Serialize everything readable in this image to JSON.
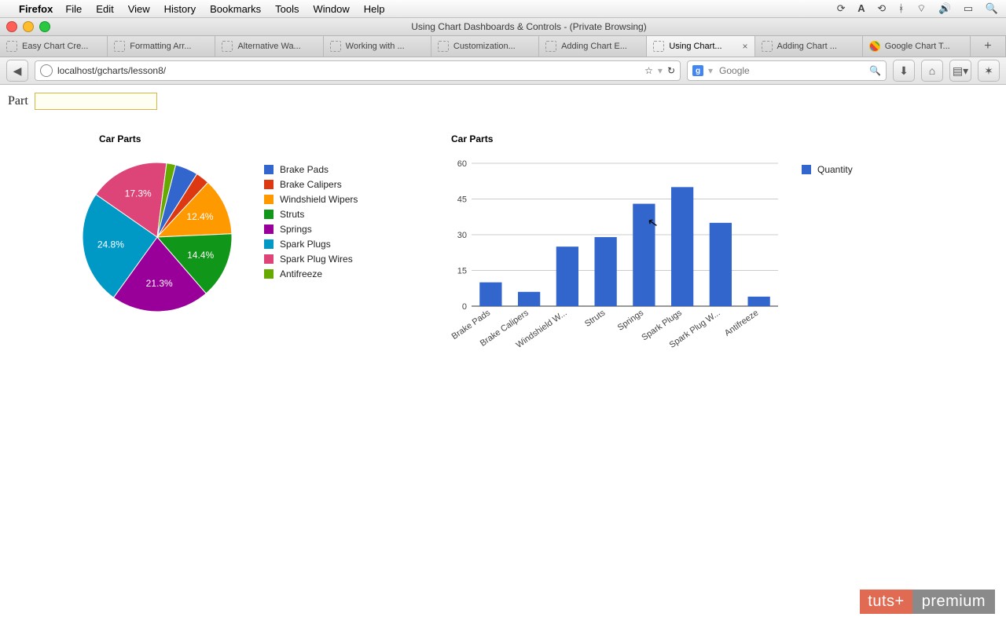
{
  "menubar": {
    "app": "Firefox",
    "items": [
      "File",
      "Edit",
      "View",
      "History",
      "Bookmarks",
      "Tools",
      "Window",
      "Help"
    ]
  },
  "window": {
    "title": "Using Chart Dashboards & Controls - (Private Browsing)"
  },
  "tabs": [
    {
      "label": "Easy Chart Cre..."
    },
    {
      "label": "Formatting Arr..."
    },
    {
      "label": "Alternative Wa..."
    },
    {
      "label": "Working with ..."
    },
    {
      "label": "Customization..."
    },
    {
      "label": "Adding Chart E..."
    },
    {
      "label": "Using Chart...",
      "active": true
    },
    {
      "label": "Adding Chart ..."
    },
    {
      "label": "Google Chart T...",
      "google": true
    }
  ],
  "url": {
    "value": "localhost/gcharts/lesson8/",
    "star": "☆",
    "reload": "↻"
  },
  "search": {
    "placeholder": "Google",
    "brand": "g",
    "magnify": "🔍"
  },
  "part_filter": {
    "label": "Part",
    "value": ""
  },
  "pie": {
    "title": "Car Parts",
    "legend": [
      "Brake Pads",
      "Brake Calipers",
      "Windshield Wipers",
      "Struts",
      "Springs",
      "Spark Plugs",
      "Spark Plug Wires",
      "Antifreeze"
    ],
    "colors": [
      "#3366cc",
      "#dc3912",
      "#ff9900",
      "#109618",
      "#990099",
      "#0099c6",
      "#dd4477",
      "#66aa00"
    ],
    "visible_labels": [
      "17.3%",
      "12.4%",
      "14.4%",
      "21.3%",
      "24.8%"
    ]
  },
  "bar": {
    "title": "Car Parts",
    "legend": "Quantity",
    "yticks": [
      "0",
      "15",
      "30",
      "45",
      "60"
    ]
  },
  "watermark": {
    "a": "tuts+",
    "b": "premium"
  },
  "chart_data": [
    {
      "type": "pie",
      "title": "Car Parts",
      "categories": [
        "Brake Pads",
        "Brake Calipers",
        "Windshield Wipers",
        "Struts",
        "Springs",
        "Spark Plugs",
        "Spark Plug Wires",
        "Antifreeze"
      ],
      "values": [
        10,
        6,
        25,
        29,
        43,
        50,
        35,
        4
      ],
      "percent_labels": {
        "Windshield Wipers": "12.4%",
        "Struts": "14.4%",
        "Springs": "21.3%",
        "Spark Plugs": "24.8%",
        "Spark Plug Wires": "17.3%"
      },
      "colors": [
        "#3366cc",
        "#dc3912",
        "#ff9900",
        "#109618",
        "#990099",
        "#0099c6",
        "#dd4477",
        "#66aa00"
      ]
    },
    {
      "type": "bar",
      "title": "Car Parts",
      "series": [
        {
          "name": "Quantity",
          "values": [
            10,
            6,
            25,
            29,
            43,
            50,
            35,
            4
          ]
        }
      ],
      "categories": [
        "Brake Pads",
        "Brake Calipers",
        "Windshield Wipers",
        "Struts",
        "Springs",
        "Spark Plugs",
        "Spark Plug Wires",
        "Antifreeze"
      ],
      "xlabel": "",
      "ylabel": "",
      "ylim": [
        0,
        60
      ],
      "yticks": [
        0,
        15,
        30,
        45,
        60
      ],
      "color": "#3366cc"
    }
  ]
}
